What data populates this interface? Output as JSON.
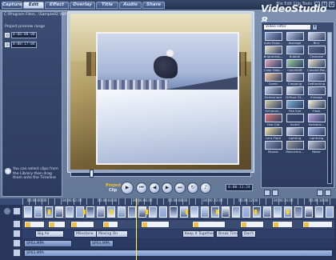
{
  "tabs": [
    "Capture",
    "Edit",
    "Effect",
    "Overlay",
    "Title",
    "Audio",
    "Share"
  ],
  "active_tab": "Edit",
  "window": {
    "title": "File Edit Clip Tools",
    "min": "_",
    "help": "?",
    "close": "×"
  },
  "brand": "VideoStudio 8",
  "left_panel": {
    "path": "C:\\Program Files\\...\\Sample02.VSP",
    "range_label": "Project preview range",
    "tc_start": "0:00:00:00",
    "tc_end": "0:00:17:04",
    "hint": "You can select clips from the Library then drag them onto the Timeline"
  },
  "transport": {
    "project_label": "Project",
    "clip_label": "Clip",
    "timecode": "0:00:11:24",
    "buttons": [
      "home",
      "rewind",
      "play",
      "forward",
      "end",
      "repeat",
      "volume"
    ]
  },
  "library": {
    "folder": "Video Filter",
    "dropdown_icon": "chevron-down",
    "items": [
      {
        "name": "Auto Expo...",
        "color": "#8fa7d6"
      },
      {
        "name": "Average",
        "color": "#b8c7e8"
      },
      {
        "name": "Blur",
        "color": "#d7def0"
      },
      {
        "name": "Brightness...",
        "color": "#e6e2c8"
      },
      {
        "name": "Bubble",
        "color": "#a5c5e8"
      },
      {
        "name": "Charcoal",
        "color": "#5d6b8c"
      },
      {
        "name": "Color Bala...",
        "color": "#d9a6b8"
      },
      {
        "name": "ColorShift",
        "color": "#9ad0a0"
      },
      {
        "name": "Colored Pen",
        "color": "#e9e3d0"
      },
      {
        "name": "Comic",
        "color": "#f0c9a0"
      },
      {
        "name": "Cropping",
        "color": "#c0c0d8"
      },
      {
        "name": "DeBlocking",
        "color": "#b0bcd8"
      },
      {
        "name": "DeInterlace",
        "color": "#c8d2e6"
      },
      {
        "name": "Diffuse Gl...",
        "color": "#e8eef8"
      },
      {
        "name": "Emboss",
        "color": "#9aa6bf"
      },
      {
        "name": "Enhance...",
        "color": "#d2c8a4"
      },
      {
        "name": "Fish Eye",
        "color": "#7fb2d8"
      },
      {
        "name": "Flash",
        "color": "#f4f0d8"
      },
      {
        "name": "Hue Cat",
        "color": "#e07a7a"
      },
      {
        "name": "Invert",
        "color": "#3c466a"
      },
      {
        "name": "Kaleidos...",
        "color": "#b6a4d8"
      },
      {
        "name": "Lens Flare",
        "color": "#f0e4a8"
      },
      {
        "name": "Lighting",
        "color": "#d8dcea"
      },
      {
        "name": "Lightning",
        "color": "#a8b8e0"
      },
      {
        "name": "Mosaic",
        "color": "#8894b6"
      },
      {
        "name": "Monochro...",
        "color": "#9a9a9a"
      },
      {
        "name": "Noise",
        "color": "#c2c6d2"
      }
    ]
  },
  "timeline": {
    "ruler": [
      "00:00:00:00",
      "00:00:02:00",
      "00:00:04:00",
      "00:00:06:00",
      "00:00:08:00",
      "00:00:10:00",
      "00:00:12:00",
      "00:00:14:00",
      "00:00:16:00"
    ],
    "titles": [
      {
        "label": "Big Air"
      },
      {
        "label": "Milestone"
      },
      {
        "label": "Moving On"
      },
      {
        "label": "Keep It Together"
      },
      {
        "label": "Break Time"
      },
      {
        "label": "Don't Fo"
      }
    ],
    "audio": [
      {
        "label": "SP03.MPA"
      },
      {
        "label": "SP03.MPA"
      }
    ],
    "music": [
      {
        "label": "SP03.MPA"
      }
    ]
  }
}
